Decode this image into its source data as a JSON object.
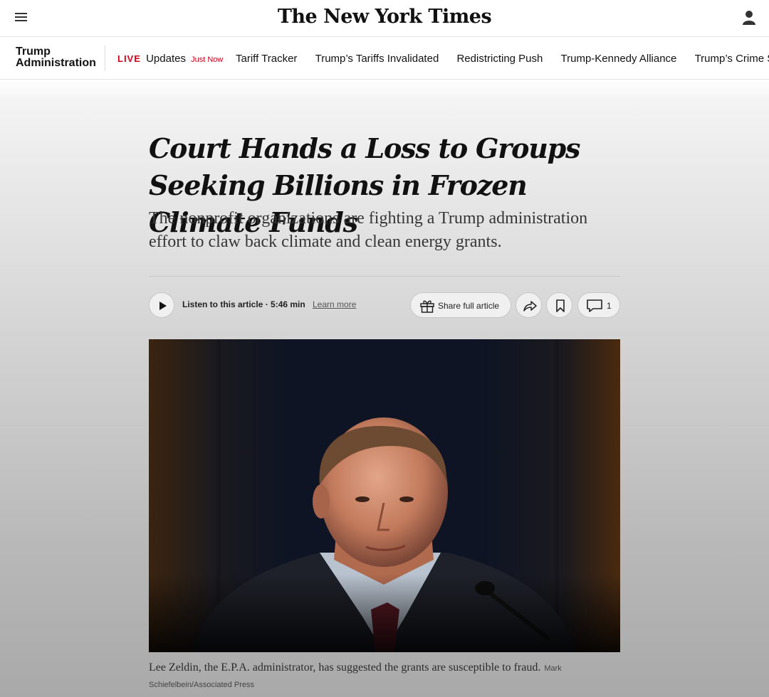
{
  "header": {
    "masthead": "The New York Times"
  },
  "nav": {
    "section": [
      "Trump",
      "Administration"
    ],
    "live_badge": "LIVE",
    "live_label": "Updates",
    "live_time": "Just Now",
    "links": [
      "Tariff Tracker",
      "Trump’s Tariffs Invalidated",
      "Redistricting Push",
      "Trump-Kennedy Alliance",
      "Trump’s Crime Strategy"
    ]
  },
  "article": {
    "headline": "Court Hands a Loss to Groups Seeking Billions in Frozen Climate Funds",
    "summary": "The nonprofit organizations are fighting a Trump administration effort to claw back climate and clean energy grants.",
    "listen_label": "Listen to this article · 5:46 min",
    "learn_more": "Learn more",
    "share_full": "Share full article",
    "comment_count": "1",
    "caption": "Lee Zeldin, the E.P.A. administrator, has suggested the grants are susceptible to fraud.",
    "credit": "Mark Schiefelbein/Associated Press"
  },
  "colors": {
    "live_red": "#d0021b",
    "text": "#121212"
  }
}
